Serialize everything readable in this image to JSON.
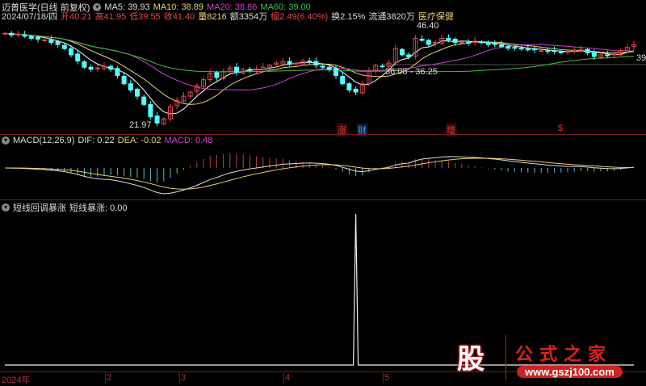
{
  "header": {
    "title": "迈普医学(日线 前复权)",
    "ma5": "MA5: 39.93",
    "ma10": "MA10: 38.89",
    "ma20": "MA20: 38.86",
    "ma60": "MA60: 39.00",
    "date": "2024/07/18/四",
    "open": "开40.21",
    "high": "高41.95",
    "low": "低39.55",
    "close": "收41.40",
    "volume": "量8216",
    "amount": "额3354万",
    "change": "幅2.49(6.40%)",
    "turnover": "换2.15%",
    "float": "流通3820万",
    "industry": "医疗保健"
  },
  "main_labels": {
    "high_mark": "46.40",
    "low_mark": "21.97",
    "range_mark": "36.08 - 36.25",
    "right_price": "39"
  },
  "markers": [
    {
      "text": "涨",
      "color": "#e03030"
    },
    {
      "text": "财",
      "color": "#40a0e0"
    },
    {
      "text": "增",
      "color": "#e03030"
    },
    {
      "text": "$",
      "color": "#e03030"
    }
  ],
  "macd": {
    "title": "MACD(12,26,9)",
    "dif": "DIF: 0.22",
    "dea": "DEA: -0.02",
    "macd": "MACD: 0.48"
  },
  "indicator": {
    "title": "短线回调暴涨",
    "value": "短线暴涨: 0.00"
  },
  "axis": [
    "2024年",
    "2",
    "3",
    "4",
    "5"
  ],
  "logo": {
    "mark": "股",
    "name": "公式之家",
    "url": "www.gszj100.com"
  },
  "colors": {
    "up": "#e04848",
    "down": "#54ffff",
    "ma5": "#ffffff",
    "ma10": "#e8d070",
    "ma20": "#d040d0",
    "ma60": "#40c040",
    "grid": "#7a1a22"
  },
  "chart_data": {
    "type": "candlestick",
    "closes": [
      44.2,
      43.8,
      44.0,
      43.5,
      43.0,
      42.8,
      42.6,
      42.0,
      41.5,
      40.5,
      39.0,
      37.5,
      36.0,
      35.5,
      35.8,
      36.2,
      35.5,
      34.0,
      32.0,
      30.5,
      29.0,
      27.0,
      24.0,
      22.5,
      23.5,
      26.5,
      28.0,
      29.0,
      30.0,
      31.5,
      33.0,
      34.5,
      33.5,
      35.0,
      35.8,
      34.8,
      35.5,
      35.2,
      35.6,
      36.0,
      36.5,
      37.0,
      37.4,
      36.8,
      37.0,
      37.5,
      37.2,
      36.5,
      36.0,
      35.5,
      34.0,
      32.0,
      30.5,
      30.0,
      32.0,
      35.0,
      36.5,
      36.2,
      37.0,
      40.5,
      39.0,
      38.5,
      43.0,
      42.5,
      41.5,
      42.0,
      43.0,
      42.6,
      42.0,
      42.0,
      41.8,
      42.3,
      42.0,
      41.5,
      41.6,
      41.0,
      40.6,
      40.8,
      40.4,
      40.3,
      40.2,
      40.0,
      39.8,
      39.9,
      39.6,
      39.8,
      40.1,
      40.3,
      39.5,
      38.6,
      39.0,
      38.8,
      39.2,
      40.0,
      40.8,
      41.4
    ],
    "signal_index": 53,
    "signal_value": 1,
    "price_range": [
      21.97,
      46.4
    ]
  }
}
